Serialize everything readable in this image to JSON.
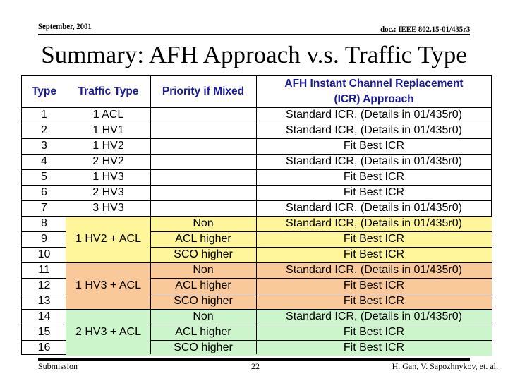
{
  "header": {
    "date": "September, 2001",
    "doc": "doc.: IEEE 802.15-01/435r3"
  },
  "title": "Summary: AFH Approach v.s. Traffic Type",
  "table": {
    "columns": [
      "Type",
      "Traffic Type",
      "Priority if Mixed",
      "AFH Instant Channel Replacement (ICR) Approach"
    ],
    "column_header_lines": {
      "approach_line1": "AFH Instant Channel Replacement",
      "approach_line2": "(ICR) Approach"
    },
    "colors": {
      "header_text": "#1a1a99",
      "band_hv2_acl": "#fff59a",
      "band_hv3_acl": "#fac99a",
      "band_2hv3_acl": "#ccf5cc"
    },
    "rows": [
      {
        "type": "1",
        "traffic": "1 ACL",
        "priority": "",
        "approach": "Standard ICR, (Details in 01/435r0)"
      },
      {
        "type": "2",
        "traffic": "1 HV1",
        "priority": "",
        "approach": "Standard ICR, (Details in 01/435r0)"
      },
      {
        "type": "3",
        "traffic": "1 HV2",
        "priority": "",
        "approach": "Fit Best ICR"
      },
      {
        "type": "4",
        "traffic": "2 HV2",
        "priority": "",
        "approach": "Standard ICR, (Details in 01/435r0)"
      },
      {
        "type": "5",
        "traffic": "1 HV3",
        "priority": "",
        "approach": "Fit Best ICR"
      },
      {
        "type": "6",
        "traffic": "2 HV3",
        "priority": "",
        "approach": "Fit Best ICR"
      },
      {
        "type": "7",
        "traffic": "3 HV3",
        "priority": "",
        "approach": "Standard ICR, (Details in 01/435r0)"
      },
      {
        "type": "8",
        "traffic": "1 HV2 + ACL",
        "priority": "Non",
        "approach": "Standard ICR, (Details in 01/435r0)",
        "band": "band_hv2_acl"
      },
      {
        "type": "9",
        "traffic": "1 HV2 + ACL",
        "priority": "ACL higher",
        "approach": "Fit Best ICR",
        "band": "band_hv2_acl"
      },
      {
        "type": "10",
        "traffic": "1 HV2 + ACL",
        "priority": "SCO higher",
        "approach": "Fit Best ICR",
        "band": "band_hv2_acl"
      },
      {
        "type": "11",
        "traffic": "1 HV3 + ACL",
        "priority": "Non",
        "approach": "Standard ICR, (Details in 01/435r0)",
        "band": "band_hv3_acl"
      },
      {
        "type": "12",
        "traffic": "1 HV3 + ACL",
        "priority": "ACL higher",
        "approach": "Fit Best ICR",
        "band": "band_hv3_acl"
      },
      {
        "type": "13",
        "traffic": "1 HV3 + ACL",
        "priority": "SCO higher",
        "approach": "Fit Best ICR",
        "band": "band_hv3_acl"
      },
      {
        "type": "14",
        "traffic": "2 HV3 + ACL",
        "priority": "Non",
        "approach": "Standard ICR, (Details in 01/435r0)",
        "band": "band_2hv3_acl"
      },
      {
        "type": "15",
        "traffic": "2 HV3 + ACL",
        "priority": "ACL higher",
        "approach": "Fit Best ICR",
        "band": "band_2hv3_acl"
      },
      {
        "type": "16",
        "traffic": "2 HV3 + ACL",
        "priority": "SCO higher",
        "approach": "Fit Best ICR",
        "band": "band_2hv3_acl"
      }
    ]
  },
  "footer": {
    "left": "Submission",
    "page": "22",
    "authors": "H. Gan, V. Sapozhnykov, et. al."
  }
}
